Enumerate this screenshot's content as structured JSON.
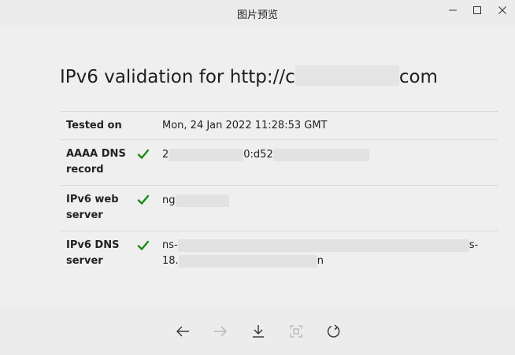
{
  "window": {
    "title": "图片预览",
    "controls": [
      "minimize-icon",
      "maximize-icon",
      "close-icon"
    ]
  },
  "page": {
    "heading_start": "IPv6 validation for http://c",
    "heading_end": "com"
  },
  "rows": [
    {
      "label": "Tested on",
      "check": false,
      "value": "Mon, 24 Jan 2022 11:28:53 GMT"
    },
    {
      "label": "AAAA DNS record",
      "check": true,
      "value_start": "2",
      "value_middle": "0:d52",
      "value_end": ""
    },
    {
      "label": "IPv6 web server",
      "check": true,
      "value_start": "ng",
      "value_end": ""
    },
    {
      "label": "IPv6 DNS server",
      "check": true,
      "value_line1_start": "ns-",
      "value_line1_end": "s-",
      "value_line2_start": "18.",
      "value_line2_end": "n"
    }
  ],
  "toolbar": {
    "buttons": [
      "back-arrow-icon",
      "forward-arrow-icon",
      "download-icon",
      "fit-to-window-icon",
      "rotate-icon"
    ]
  },
  "colors": {
    "check_green": "#1a8a1a",
    "background": "#efefef",
    "divider": "#d7d7d7"
  }
}
